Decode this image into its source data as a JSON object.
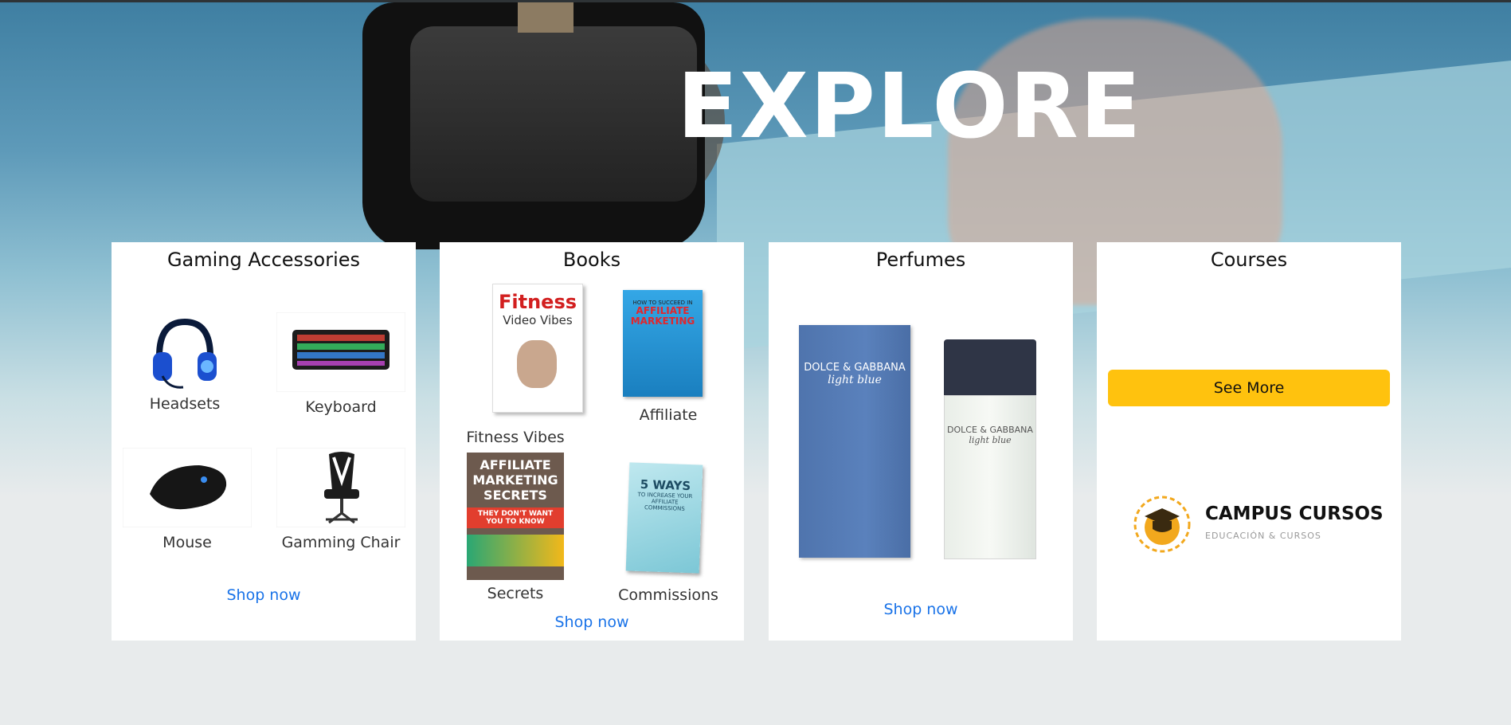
{
  "hero": {
    "title": "EXPLORE"
  },
  "cards": [
    {
      "title": "Gaming Accessories",
      "items": [
        {
          "label": "Headsets",
          "icon": "headset-icon"
        },
        {
          "label": "Keyboard",
          "icon": "keyboard-icon"
        },
        {
          "label": "Mouse",
          "icon": "mouse-icon"
        },
        {
          "label": "Gamming Chair",
          "icon": "gaming-chair-icon"
        }
      ],
      "link": "Shop now"
    },
    {
      "title": "Books",
      "items": [
        {
          "label": "Fitness Vibes",
          "cover": {
            "line1": "Fitness",
            "line2": "Video Vibes"
          }
        },
        {
          "label": "Affiliate",
          "cover": {
            "line1": "HOW TO SUCCEED IN",
            "line2": "AFFILIATE MARKETING"
          }
        },
        {
          "label": "Secrets",
          "cover": {
            "line1": "AFFILIATE MARKETING SECRETS",
            "line2": "THEY DON'T WANT YOU TO KNOW"
          }
        },
        {
          "label": "Commissions",
          "cover": {
            "line1": "5 WAYS",
            "line2": "TO INCREASE YOUR AFFILIATE COMMISSIONS"
          }
        }
      ],
      "link": "Shop now"
    },
    {
      "title": "Perfumes",
      "product": {
        "brand": "DOLCE & GABBANA",
        "name": "light blue"
      },
      "link": "Shop now"
    },
    {
      "title": "Courses",
      "button": "See More",
      "logo": {
        "name": "CAMPUS CURSOS",
        "tagline": "EDUCACIÓN & CURSOS"
      }
    }
  ],
  "colors": {
    "accent": "#1a73e8",
    "button": "#ffc20e"
  }
}
